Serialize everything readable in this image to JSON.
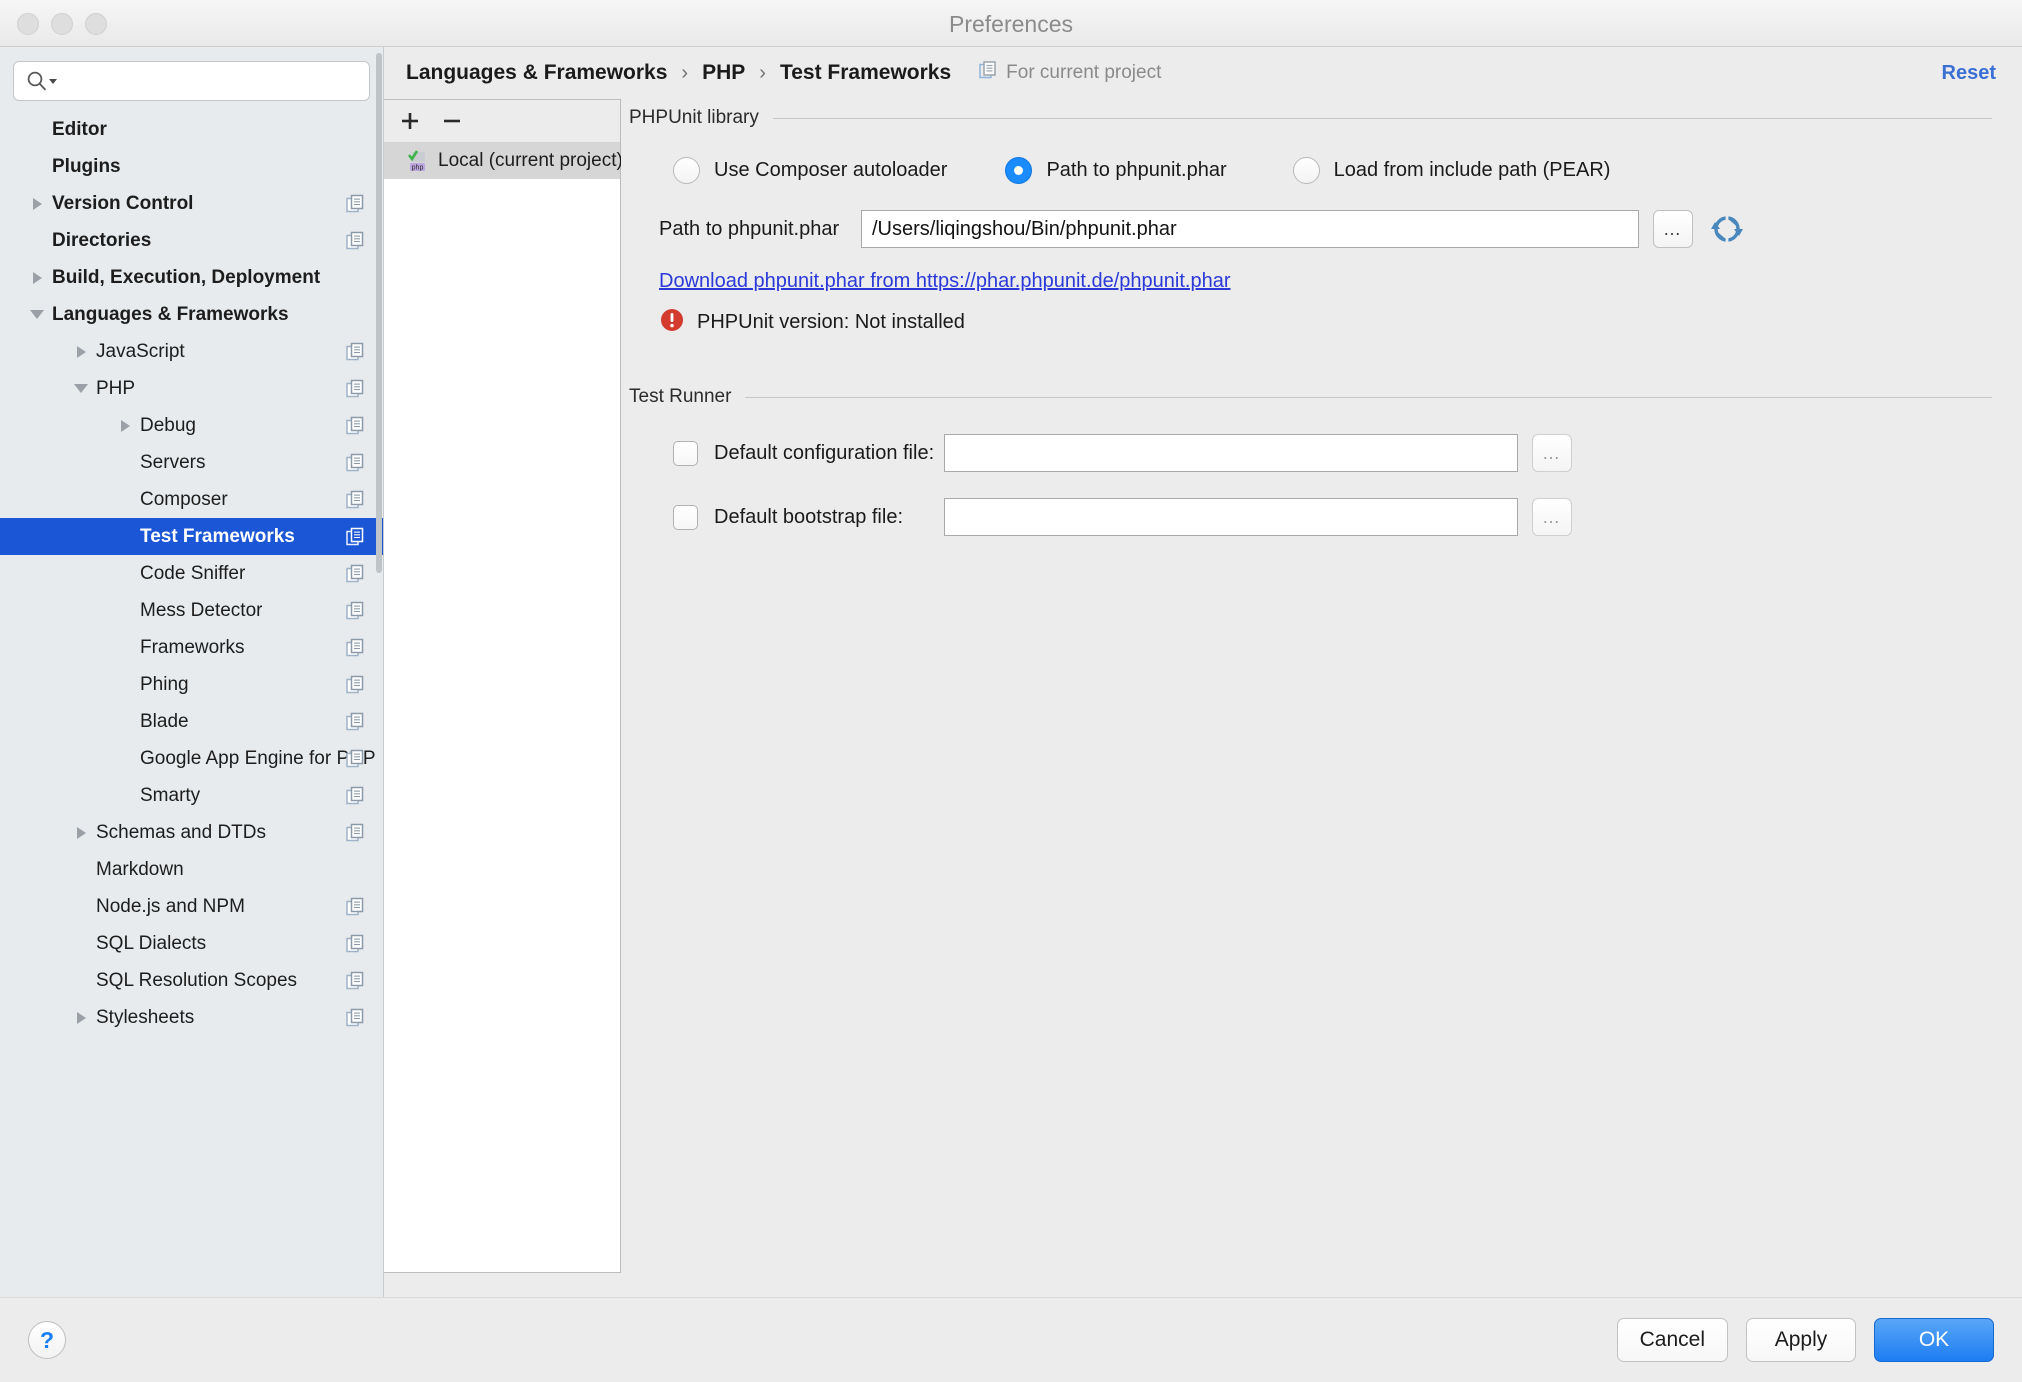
{
  "window": {
    "title": "Preferences",
    "traffic_lights": [
      "close-button",
      "minimize-button",
      "zoom-button"
    ]
  },
  "search": {
    "value": "",
    "placeholder": "",
    "icon": "search-icon"
  },
  "sidebar": {
    "scrollbar": true,
    "items": [
      {
        "label": "Editor",
        "indent": 0,
        "bold": true,
        "arrow": "none",
        "copy_icon": false
      },
      {
        "label": "Plugins",
        "indent": 0,
        "bold": true,
        "arrow": "none",
        "copy_icon": false
      },
      {
        "label": "Version Control",
        "indent": 0,
        "bold": true,
        "arrow": "right",
        "copy_icon": true
      },
      {
        "label": "Directories",
        "indent": 0,
        "bold": true,
        "arrow": "none",
        "copy_icon": true
      },
      {
        "label": "Build, Execution, Deployment",
        "indent": 0,
        "bold": true,
        "arrow": "right",
        "copy_icon": false
      },
      {
        "label": "Languages & Frameworks",
        "indent": 0,
        "bold": true,
        "arrow": "down",
        "copy_icon": false
      },
      {
        "label": "JavaScript",
        "indent": 1,
        "bold": false,
        "arrow": "right",
        "copy_icon": true
      },
      {
        "label": "PHP",
        "indent": 1,
        "bold": false,
        "arrow": "down",
        "copy_icon": true
      },
      {
        "label": "Debug",
        "indent": 2,
        "bold": false,
        "arrow": "right",
        "copy_icon": true
      },
      {
        "label": "Servers",
        "indent": 2,
        "bold": false,
        "arrow": "none",
        "copy_icon": true
      },
      {
        "label": "Composer",
        "indent": 2,
        "bold": false,
        "arrow": "none",
        "copy_icon": true
      },
      {
        "label": "Test Frameworks",
        "indent": 2,
        "bold": false,
        "arrow": "none",
        "copy_icon": true,
        "selected": true
      },
      {
        "label": "Code Sniffer",
        "indent": 2,
        "bold": false,
        "arrow": "none",
        "copy_icon": true
      },
      {
        "label": "Mess Detector",
        "indent": 2,
        "bold": false,
        "arrow": "none",
        "copy_icon": true
      },
      {
        "label": "Frameworks",
        "indent": 2,
        "bold": false,
        "arrow": "none",
        "copy_icon": true
      },
      {
        "label": "Phing",
        "indent": 2,
        "bold": false,
        "arrow": "none",
        "copy_icon": true
      },
      {
        "label": "Blade",
        "indent": 2,
        "bold": false,
        "arrow": "none",
        "copy_icon": true
      },
      {
        "label": "Google App Engine for PHP",
        "indent": 2,
        "bold": false,
        "arrow": "none",
        "copy_icon": true
      },
      {
        "label": "Smarty",
        "indent": 2,
        "bold": false,
        "arrow": "none",
        "copy_icon": true
      },
      {
        "label": "Schemas and DTDs",
        "indent": 1,
        "bold": false,
        "arrow": "right",
        "copy_icon": true
      },
      {
        "label": "Markdown",
        "indent": 1,
        "bold": false,
        "arrow": "none",
        "copy_icon": false
      },
      {
        "label": "Node.js and NPM",
        "indent": 1,
        "bold": false,
        "arrow": "none",
        "copy_icon": true
      },
      {
        "label": "SQL Dialects",
        "indent": 1,
        "bold": false,
        "arrow": "none",
        "copy_icon": true
      },
      {
        "label": "SQL Resolution Scopes",
        "indent": 1,
        "bold": false,
        "arrow": "none",
        "copy_icon": true
      },
      {
        "label": "Stylesheets",
        "indent": 1,
        "bold": false,
        "arrow": "right",
        "copy_icon": true
      }
    ]
  },
  "header": {
    "breadcrumb": [
      "Languages & Frameworks",
      "PHP",
      "Test Frameworks"
    ],
    "separator": "›",
    "scope_label": "For current project",
    "scope_icon": "project-scope-icon",
    "reset_label": "Reset"
  },
  "interpreter_list": {
    "add_label": "+",
    "remove_label": "−",
    "items": [
      {
        "label": "Local (current project)",
        "icon": "php-interpreter-icon",
        "selected": true
      }
    ]
  },
  "phpunit_library": {
    "group_title": "PHPUnit library",
    "options": [
      {
        "label": "Use Composer autoloader",
        "selected": false
      },
      {
        "label": "Path to phpunit.phar",
        "selected": true
      },
      {
        "label": "Load from include path (PEAR)",
        "selected": false
      }
    ],
    "path_label": "Path to phpunit.phar",
    "path_value": "/Users/liqingshou/Bin/phpunit.phar",
    "browse_label": "…",
    "refresh_icon": "refresh-icon",
    "download_link": "Download phpunit.phar from https://phar.phpunit.de/phpunit.phar",
    "status_icon": "error-icon",
    "status_text": "PHPUnit version: Not installed"
  },
  "test_runner": {
    "group_title": "Test Runner",
    "rows": [
      {
        "label": "Default configuration file:",
        "checked": false,
        "value": "",
        "browse_label": "…"
      },
      {
        "label": "Default bootstrap file:",
        "checked": false,
        "value": "",
        "browse_label": "…"
      }
    ]
  },
  "footer": {
    "help_label": "?",
    "cancel_label": "Cancel",
    "apply_label": "Apply",
    "ok_label": "OK"
  },
  "colors": {
    "selection_blue": "#1a56d6",
    "accent_blue": "#1a8cff",
    "link_blue": "#2b39d8",
    "reset_blue": "#3b6fd4",
    "error_red": "#d23b2e",
    "sidebar_bg": "#e7ebee",
    "panel_bg": "#ececec"
  }
}
